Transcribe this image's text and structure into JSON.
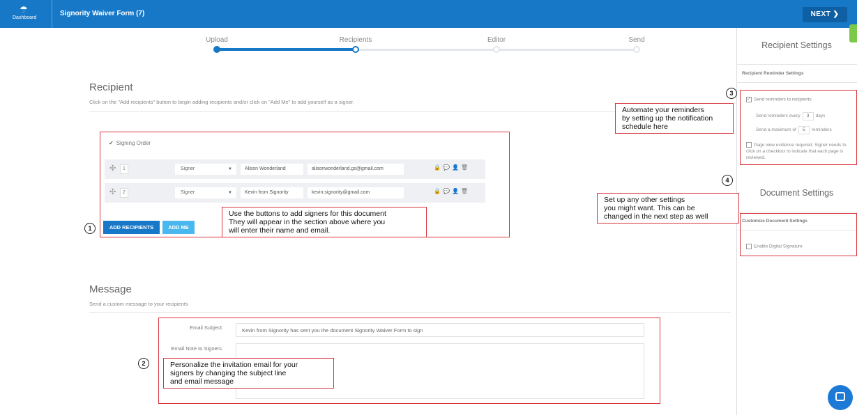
{
  "header": {
    "dashboard_label": "Dashboard",
    "document_title": "Signority Waiver Form (7)",
    "next_label": "NEXT ❯"
  },
  "steps": [
    {
      "label": "Upload"
    },
    {
      "label": "Recipients"
    },
    {
      "label": "Editor"
    },
    {
      "label": "Send"
    }
  ],
  "recipient": {
    "title": "Recipient",
    "description": "Click on the \"Add recipients\" button to begin adding recipients and/or click on \"Add Me\" to add yourself as a signer.",
    "signing_order_label": "Signing Order",
    "rows": [
      {
        "order": "1",
        "role": "Signer",
        "name": "Alison Wonderland",
        "email": "alisonwonderland.gs@gmail.com"
      },
      {
        "order": "2",
        "role": "Signer",
        "name": "Kevin from Signority",
        "email": "kevin.signority@gmail.com"
      }
    ],
    "add_recipients_label": "ADD RECIPIENTS",
    "add_me_label": "ADD ME"
  },
  "message": {
    "title": "Message",
    "description": "Send a custom message to your recipients",
    "subject_label": "Email Subject:",
    "subject_value": "Kevin from Signority has sent you the document Signority Waiver Form to sign",
    "note_label": "Email Note to Signers:"
  },
  "right_panel": {
    "recipient_settings_title": "Recipient Settings",
    "reminder_settings_label": "Recipient Reminder Settings",
    "send_reminders_label": "Send reminders to recipients",
    "remind_every_prefix": "Send reminders every",
    "remind_every_value": "3",
    "remind_every_suffix": "days",
    "remind_max_prefix": "Send a maximum of",
    "remind_max_value": "5",
    "remind_max_suffix": "reminders",
    "page_view_text": "Page view evidence required. Signer needs to click on a checkbox to indicate that each page is reviewed.",
    "document_settings_title": "Document Settings",
    "customize_label": "Customize Document Settings",
    "digital_signature_label": "Enable Digital Signature"
  },
  "annotations": {
    "badge1": "1",
    "badge2": "2",
    "badge3": "3",
    "badge4": "4",
    "callout_buttons": [
      "Use the buttons to add signers for this document",
      "They will appear in the section above where you",
      "will enter their name and email."
    ],
    "callout_email": [
      "Personalize the invitation email for your",
      "signers by changing the subject line",
      "and email message"
    ],
    "callout_reminders": [
      "Automate your reminders",
      "by setting up the notification",
      "schedule here"
    ],
    "callout_settings": [
      "Set up any other settings",
      "you might want. This can be",
      "changed in the next step as well"
    ]
  },
  "colors": {
    "primary": "#1778c7",
    "accent_light": "#4ab8ee",
    "annotation_red": "#d8343c"
  }
}
